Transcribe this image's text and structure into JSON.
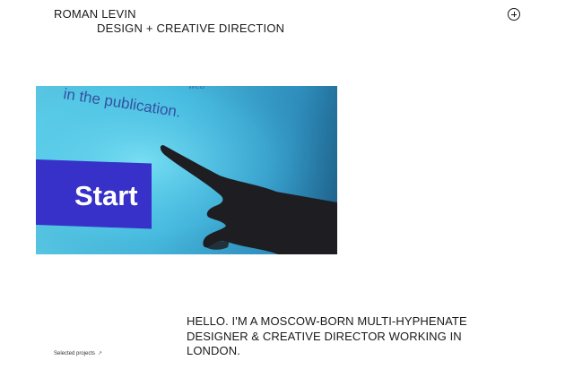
{
  "header": {
    "name": "ROMAN LEVIN",
    "tagline": "DESIGN + CREATIVE DIRECTION",
    "menu_icon": "plus-circle-icon"
  },
  "hero": {
    "screen_text": "in the publication.",
    "screen_button_label": "Start",
    "colors": {
      "screen_blue": "#4cc3e6",
      "button_blue": "#3730c9",
      "hand": "#1d1d22"
    }
  },
  "intro": {
    "text": "HELLO. I'M A MOSCOW-BORN MULTI-HYPHENATE DESIGNER & CREATIVE DIRECTOR WORKING IN LONDON."
  },
  "footer": {
    "selected_projects_label": "Selected projects",
    "arrow_icon": "arrow-down-icon",
    "arrow_glyph": "↗"
  }
}
